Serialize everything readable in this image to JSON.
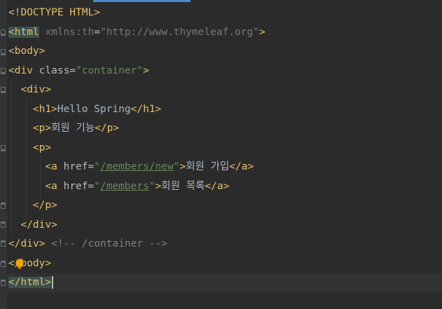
{
  "editor": {
    "lines": [
      {
        "parts": [
          [
            "t-doctype",
            "<!DOCTYPE HTML>"
          ]
        ]
      },
      {
        "parts": [
          [
            "hl-tag",
            "<html"
          ],
          [
            "t-attr-dim",
            " xmlns:th"
          ],
          [
            "t-text",
            "="
          ],
          [
            "t-attr-dim",
            "\"http://www.thymeleaf.org\""
          ],
          [
            "t-tag",
            ">"
          ]
        ]
      },
      {
        "parts": [
          [
            "t-tag",
            "<body>"
          ]
        ]
      },
      {
        "parts": [
          [
            "t-tag",
            "<div"
          ],
          [
            "t-attr",
            " class"
          ],
          [
            "t-text",
            "="
          ],
          [
            "t-str",
            "\"container\""
          ],
          [
            "t-tag",
            ">"
          ]
        ]
      },
      {
        "parts": [
          [
            "t-text",
            "  "
          ],
          [
            "t-tag",
            "<div>"
          ]
        ]
      },
      {
        "parts": [
          [
            "t-text",
            "    "
          ],
          [
            "t-tag",
            "<h1>"
          ],
          [
            "t-text",
            "Hello Spring"
          ],
          [
            "t-tag",
            "</h1>"
          ]
        ]
      },
      {
        "parts": [
          [
            "t-text",
            "    "
          ],
          [
            "t-tag",
            "<p>"
          ],
          [
            "t-text",
            "회원 기능"
          ],
          [
            "t-tag",
            "</p>"
          ]
        ]
      },
      {
        "parts": [
          [
            "t-text",
            "    "
          ],
          [
            "t-tag",
            "<p>"
          ]
        ]
      },
      {
        "parts": [
          [
            "t-text",
            "      "
          ],
          [
            "t-tag",
            "<a"
          ],
          [
            "t-attr",
            " href"
          ],
          [
            "t-text",
            "="
          ],
          [
            "t-str",
            "\""
          ],
          [
            "t-link",
            "/members/new"
          ],
          [
            "t-str",
            "\""
          ],
          [
            "t-tag",
            ">"
          ],
          [
            "t-text",
            "회원 가입"
          ],
          [
            "t-tag",
            "</a>"
          ]
        ]
      },
      {
        "parts": [
          [
            "t-text",
            "      "
          ],
          [
            "t-tag",
            "<a"
          ],
          [
            "t-attr",
            " href"
          ],
          [
            "t-text",
            "="
          ],
          [
            "t-str",
            "\""
          ],
          [
            "t-link",
            "/members"
          ],
          [
            "t-str",
            "\""
          ],
          [
            "t-tag",
            ">"
          ],
          [
            "t-text",
            "회원 목록"
          ],
          [
            "t-tag",
            "</a>"
          ]
        ]
      },
      {
        "parts": [
          [
            "t-text",
            "    "
          ],
          [
            "t-tag",
            "</p>"
          ]
        ]
      },
      {
        "parts": [
          [
            "t-text",
            "  "
          ],
          [
            "t-tag",
            "</div>"
          ]
        ]
      },
      {
        "parts": [
          [
            "t-tag",
            "</div>"
          ],
          [
            "t-comment",
            " <!-- /container -->"
          ]
        ]
      },
      {
        "parts": [
          [
            "t-tag",
            "</body>"
          ]
        ]
      },
      {
        "parts": [
          [
            "hl-tag",
            "</html>"
          ]
        ]
      }
    ]
  },
  "colors": {
    "background": "#2b2b2b",
    "tag": "#e8bf6a",
    "string": "#6a8759",
    "comment": "#808080",
    "text": "#a9b7c6"
  },
  "icons": {
    "intention_bulb": "lightbulb-icon"
  }
}
